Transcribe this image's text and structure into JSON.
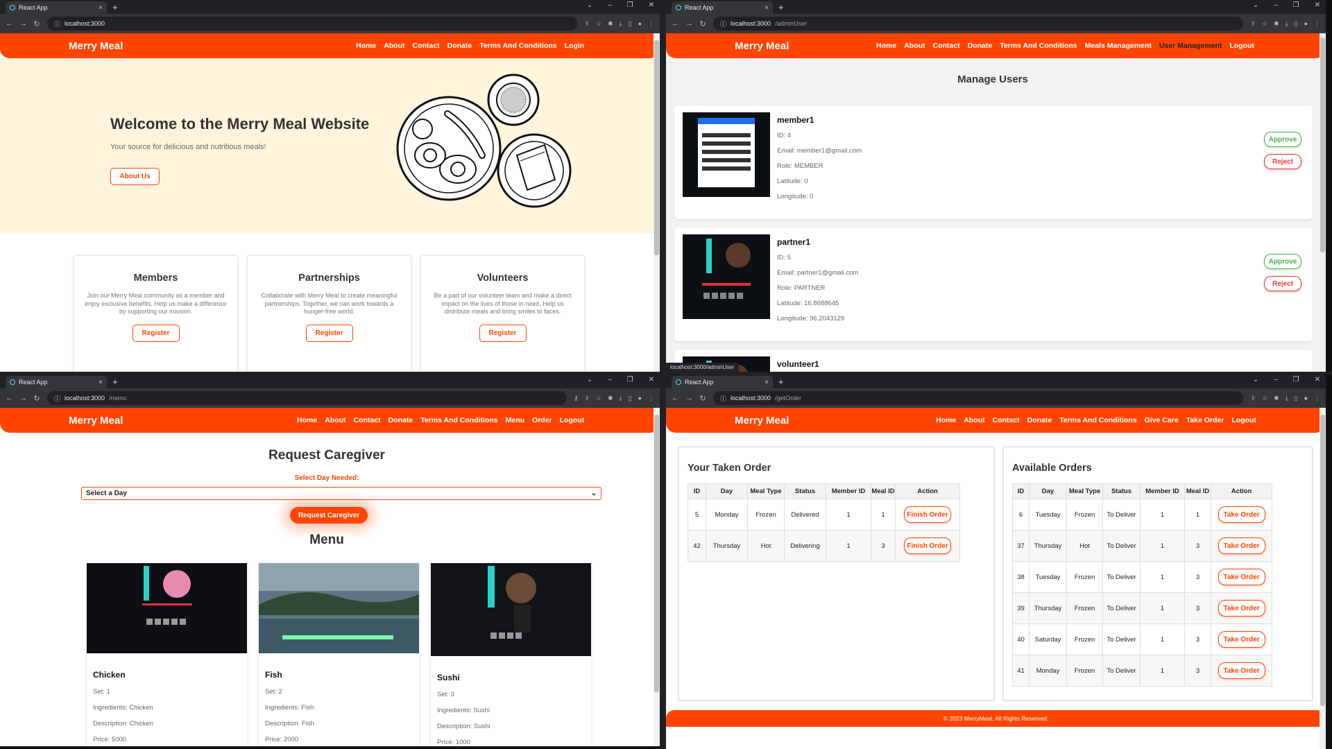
{
  "windows": [
    {
      "tab_title": "React App",
      "url_host": "localhost:3000",
      "url_path": "",
      "nav": {
        "logo": "Merry Meal",
        "links": [
          "Home",
          "About",
          "Contact",
          "Donate",
          "Terms And Conditions",
          "Login"
        ]
      },
      "hero": {
        "title": "Welcome to the Merry Meal Website",
        "subtitle": "Your source for delicious and nutritious meals!",
        "button": "About Us"
      },
      "cards": [
        {
          "title": "Members",
          "text": "Join our Merry Meal community as a member and enjoy exclusive benefits. Help us make a difference by supporting our mission.",
          "button": "Register"
        },
        {
          "title": "Partnerships",
          "text": "Collaborate with Merry Meal to create meaningful partnerships. Together, we can work towards a hunger-free world.",
          "button": "Register"
        },
        {
          "title": "Volunteers",
          "text": "Be a part of our volunteer team and make a direct impact on the lives of those in need. Help us distribute meals and bring smiles to faces.",
          "button": "Register"
        }
      ]
    },
    {
      "tab_title": "React App",
      "url_host": "localhost:3000",
      "url_path": "/adminUser",
      "nav": {
        "logo": "Merry Meal",
        "links": [
          "Home",
          "About",
          "Contact",
          "Donate",
          "Terms And Conditions",
          "Meals Management",
          "User Management",
          "Logout"
        ],
        "active": "User Management"
      },
      "heading": "Manage Users",
      "users": [
        {
          "name": "member1",
          "id": "ID: 4",
          "email": "Email: member1@gmail.com",
          "role": "Role: MEMBER",
          "lat": "Latitude: 0",
          "lng": "Longitude: 0"
        },
        {
          "name": "partner1",
          "id": "ID: 5",
          "email": "Email: partner1@gmail.com",
          "role": "Role: PARTNER",
          "lat": "Latitude: 16.8688645",
          "lng": "Longitude: 96.2043129"
        },
        {
          "name": "volunteer1"
        }
      ],
      "approve_label": "Approve",
      "reject_label": "Reject",
      "status_url": "localhost:3000/adminUser"
    },
    {
      "tab_title": "React App",
      "url_host": "localhost:3000",
      "url_path": "/menu",
      "nav": {
        "logo": "Merry Meal",
        "links": [
          "Home",
          "About",
          "Contact",
          "Donate",
          "Terms And Conditions",
          "Menu",
          "Order",
          "Logout"
        ]
      },
      "request": {
        "title": "Request Caregiver",
        "label": "Select Day Needed:",
        "select_value": "Select a Day",
        "button": "Request Caregiver"
      },
      "menu_title": "Menu",
      "meals": [
        {
          "name": "Chicken",
          "set": "Set: 1",
          "ingredients": "Ingredients: Chicken",
          "description": "Description: Chicken",
          "price": "Price: 5000"
        },
        {
          "name": "Fish",
          "set": "Set: 2",
          "ingredients": "Ingredients: Fish",
          "description": "Description: Fish",
          "price": "Price: 2000"
        },
        {
          "name": "Sushi",
          "set": "Set: 3",
          "ingredients": "Ingredients: Sushi",
          "description": "Description: Sushi",
          "price": "Price: 1000"
        }
      ]
    },
    {
      "tab_title": "React App",
      "url_host": "localhost:3000",
      "url_path": "/getOrder",
      "nav": {
        "logo": "Merry Meal",
        "links": [
          "Home",
          "About",
          "Contact",
          "Donate",
          "Terms And Conditions",
          "Give Care",
          "Take Order",
          "Logout"
        ]
      },
      "taken": {
        "title": "Your Taken Order",
        "headers": [
          "ID",
          "Day",
          "Meal Type",
          "Status",
          "Member ID",
          "Meal ID",
          "Action"
        ],
        "rows": [
          [
            "5",
            "Monday",
            "Frozen",
            "Delivered",
            "1",
            "1",
            "Finish Order"
          ],
          [
            "42",
            "Thursday",
            "Hot",
            "Delivering",
            "1",
            "3",
            "Finish Order"
          ]
        ]
      },
      "available": {
        "title": "Available Orders",
        "headers": [
          "ID",
          "Day",
          "Meal Type",
          "Status",
          "Member ID",
          "Meal ID",
          "Action"
        ],
        "rows": [
          [
            "6",
            "Tuesday",
            "Frozen",
            "To Deliver",
            "1",
            "1",
            "Take Order"
          ],
          [
            "37",
            "Thursday",
            "Hot",
            "To Deliver",
            "1",
            "3",
            "Take Order"
          ],
          [
            "38",
            "Tuesday",
            "Frozen",
            "To Deliver",
            "1",
            "3",
            "Take Order"
          ],
          [
            "39",
            "Thursday",
            "Frozen",
            "To Deliver",
            "1",
            "3",
            "Take Order"
          ],
          [
            "40",
            "Saturday",
            "Frozen",
            "To Deliver",
            "1",
            "3",
            "Take Order"
          ],
          [
            "41",
            "Monday",
            "Frozen",
            "To Deliver",
            "1",
            "3",
            "Take Order"
          ]
        ]
      },
      "footer": "© 2023 MerryMeal. All Rights Reserved."
    }
  ],
  "colors": {
    "brand": "#ff4500",
    "hero_bg": "#fff4dc",
    "approve": "#4caf50",
    "reject": "#e53935"
  }
}
